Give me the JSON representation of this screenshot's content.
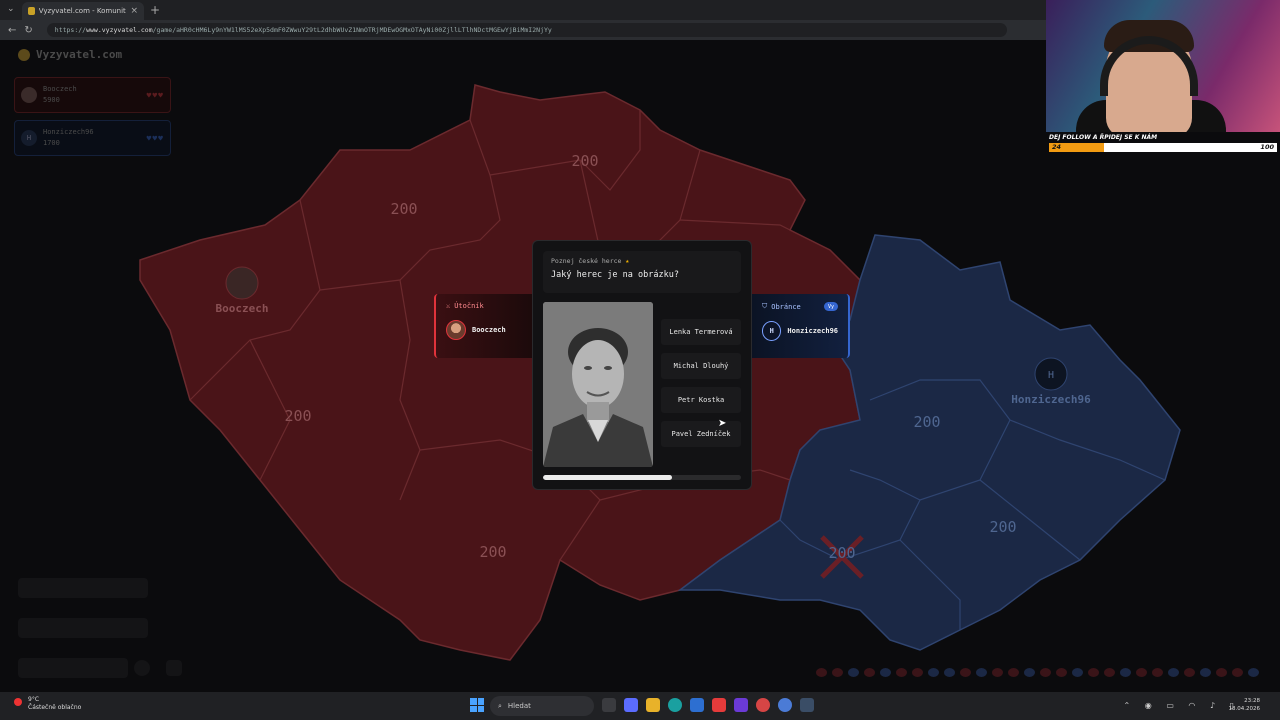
{
  "browser": {
    "tab_title": "Vyzyvatel.com - Komunitní vě",
    "url_prefix": "https://",
    "url_host": "www.vyzyvatel.com",
    "url_path": "/game/aHR0cHM6Ly9nYW1lMS52eXp5dmF0ZWwuY29tL2dhbWUvZ1NmOTRjMDEwOGMxOTAyNi00ZjllLTlhNDctMGEwYjBiMmI2NjYy"
  },
  "game": {
    "logo": "Vyzyvatel.com",
    "players": [
      {
        "name": "Booczech",
        "score": "5900",
        "hearts": "♥♥♥"
      },
      {
        "name": "Honziczech96",
        "score": "1700",
        "hearts": "♥♥♥",
        "initial": "H"
      }
    ],
    "map_labels": {
      "north": "200",
      "northwest": "200",
      "center": "200",
      "west": "200",
      "south": "200",
      "east": "200",
      "southeast": "200",
      "battle": "200",
      "player_red": "Booczech",
      "player_blue": "Honziczech96",
      "player_blue_initial": "H"
    },
    "colors": {
      "red_region": "#4a1418",
      "blue_region": "#1b2845",
      "attacker": "#e0333b",
      "defender": "#3566d0"
    }
  },
  "question": {
    "category": "Poznej české herce",
    "text": "Jaký herec je na obrázku?",
    "answers": [
      "Lenka Termerová",
      "Michal Dlouhý",
      "Petr Kostka",
      "Pavel Zedníček"
    ],
    "progress": 0.65
  },
  "attacker": {
    "role": "Útočník",
    "name": "Booczech"
  },
  "defender": {
    "role": "Obránce",
    "name": "Honziczech96",
    "initial": "H",
    "badge": "Vy"
  },
  "stream": {
    "follow_text": "DEJ FOLLOW A ŘPIDEJ SE K NÁM",
    "current": "24",
    "goal": "100",
    "progress": 0.24
  },
  "taskbar": {
    "weather_temp": "9°C",
    "weather_desc": "Částečně oblačno",
    "search_placeholder": "Hledat",
    "time": "23:28",
    "date": "18.04.2026"
  }
}
